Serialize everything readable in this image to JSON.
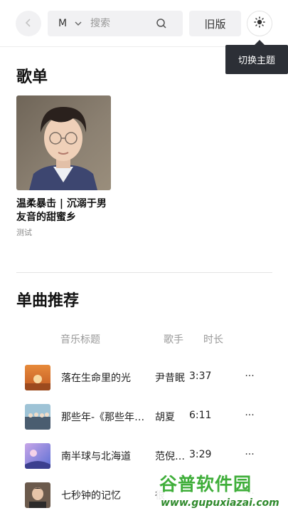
{
  "header": {
    "search_source": "M",
    "search_placeholder": "搜索",
    "old_version_label": "旧版",
    "theme_tooltip": "切换主题"
  },
  "playlists": {
    "title": "歌单",
    "items": [
      {
        "name": "温柔暴击 | 沉溺于男友音的甜蜜乡",
        "desc": "测试"
      }
    ]
  },
  "songs": {
    "title": "单曲推荐",
    "columns": {
      "title": "音乐标题",
      "artist": "歌手",
      "duration": "时长"
    },
    "rows": [
      {
        "title": "落在生命里的光",
        "artist": "尹昔眠",
        "duration": "3:37",
        "more": "···"
      },
      {
        "title": "那些年-《那些年，我们一起追的女孩》电影主题曲",
        "artist": "胡夏",
        "duration": "6:11",
        "more": "···"
      },
      {
        "title": "南半球与北海道",
        "artist": "范倪Liu",
        "duration": "3:29",
        "more": "···"
      },
      {
        "title": "七秒钟的记忆",
        "artist": "很",
        "duration": "",
        "more": "···"
      }
    ]
  },
  "watermark": {
    "main": "谷普软件园",
    "url": "www.gupuxiazai.com"
  },
  "colors": {
    "accent_green": "#3fae3a",
    "tooltip_bg": "#2c2f36",
    "control_bg": "#f1f1f3"
  }
}
